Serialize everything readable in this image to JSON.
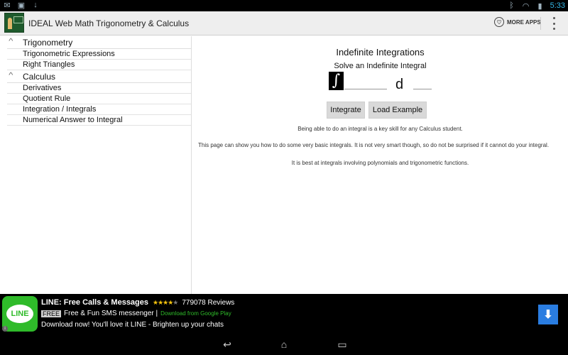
{
  "status_bar": {
    "left_icons": [
      "email-icon",
      "image-icon",
      "download-icon"
    ],
    "right_icons": [
      "bluetooth-icon",
      "wifi-icon",
      "battery-icon"
    ],
    "time": "5:33"
  },
  "action_bar": {
    "title": "IDEAL Web Math Trigonometry & Calculus",
    "more_apps_label": "MORE APPS"
  },
  "sidebar": {
    "groups": [
      {
        "label": "Trigonometry",
        "items": [
          "Trigonometric Expressions",
          "Right Triangles"
        ]
      },
      {
        "label": "Calculus",
        "items": [
          "Derivatives",
          "Quotient Rule",
          "Integration / Integrals",
          "Numerical Answer to Integral"
        ]
      }
    ]
  },
  "main": {
    "title": "Indefinite Integrations",
    "subtitle": "Solve an Indefinite Integral",
    "integral_symbol": "∫",
    "integrand_value": "",
    "d_label": "d",
    "variable_value": "",
    "buttons": {
      "integrate": "Integrate",
      "load_example": "Load Example"
    },
    "paragraphs": [
      "Being able to do an integral is a key skill for any Calculus student.",
      "This page can show you how to do some very basic integrals. It is not very smart though, so do not be surprised if it cannot do your integral.",
      "It is best at integrals involving polynomials and trigonometric functions."
    ]
  },
  "ad": {
    "title": "LINE: Free Calls & Messages",
    "stars_filled": "★★★★",
    "stars_empty": "★",
    "reviews": "779078 Reviews",
    "free_badge": "FREE",
    "line2_text": "Free & Fun SMS messenger |",
    "source": "Download from Google Play",
    "line3": "Download now! You'll love it LINE - Brighten up your chats",
    "logo_text": "LINE",
    "colors": {
      "line_green": "#2fbb2a",
      "download_blue": "#2a7de1"
    }
  },
  "colors": {
    "clock_blue": "#33b5e5",
    "actionbar_bg": "#eeeeee"
  }
}
